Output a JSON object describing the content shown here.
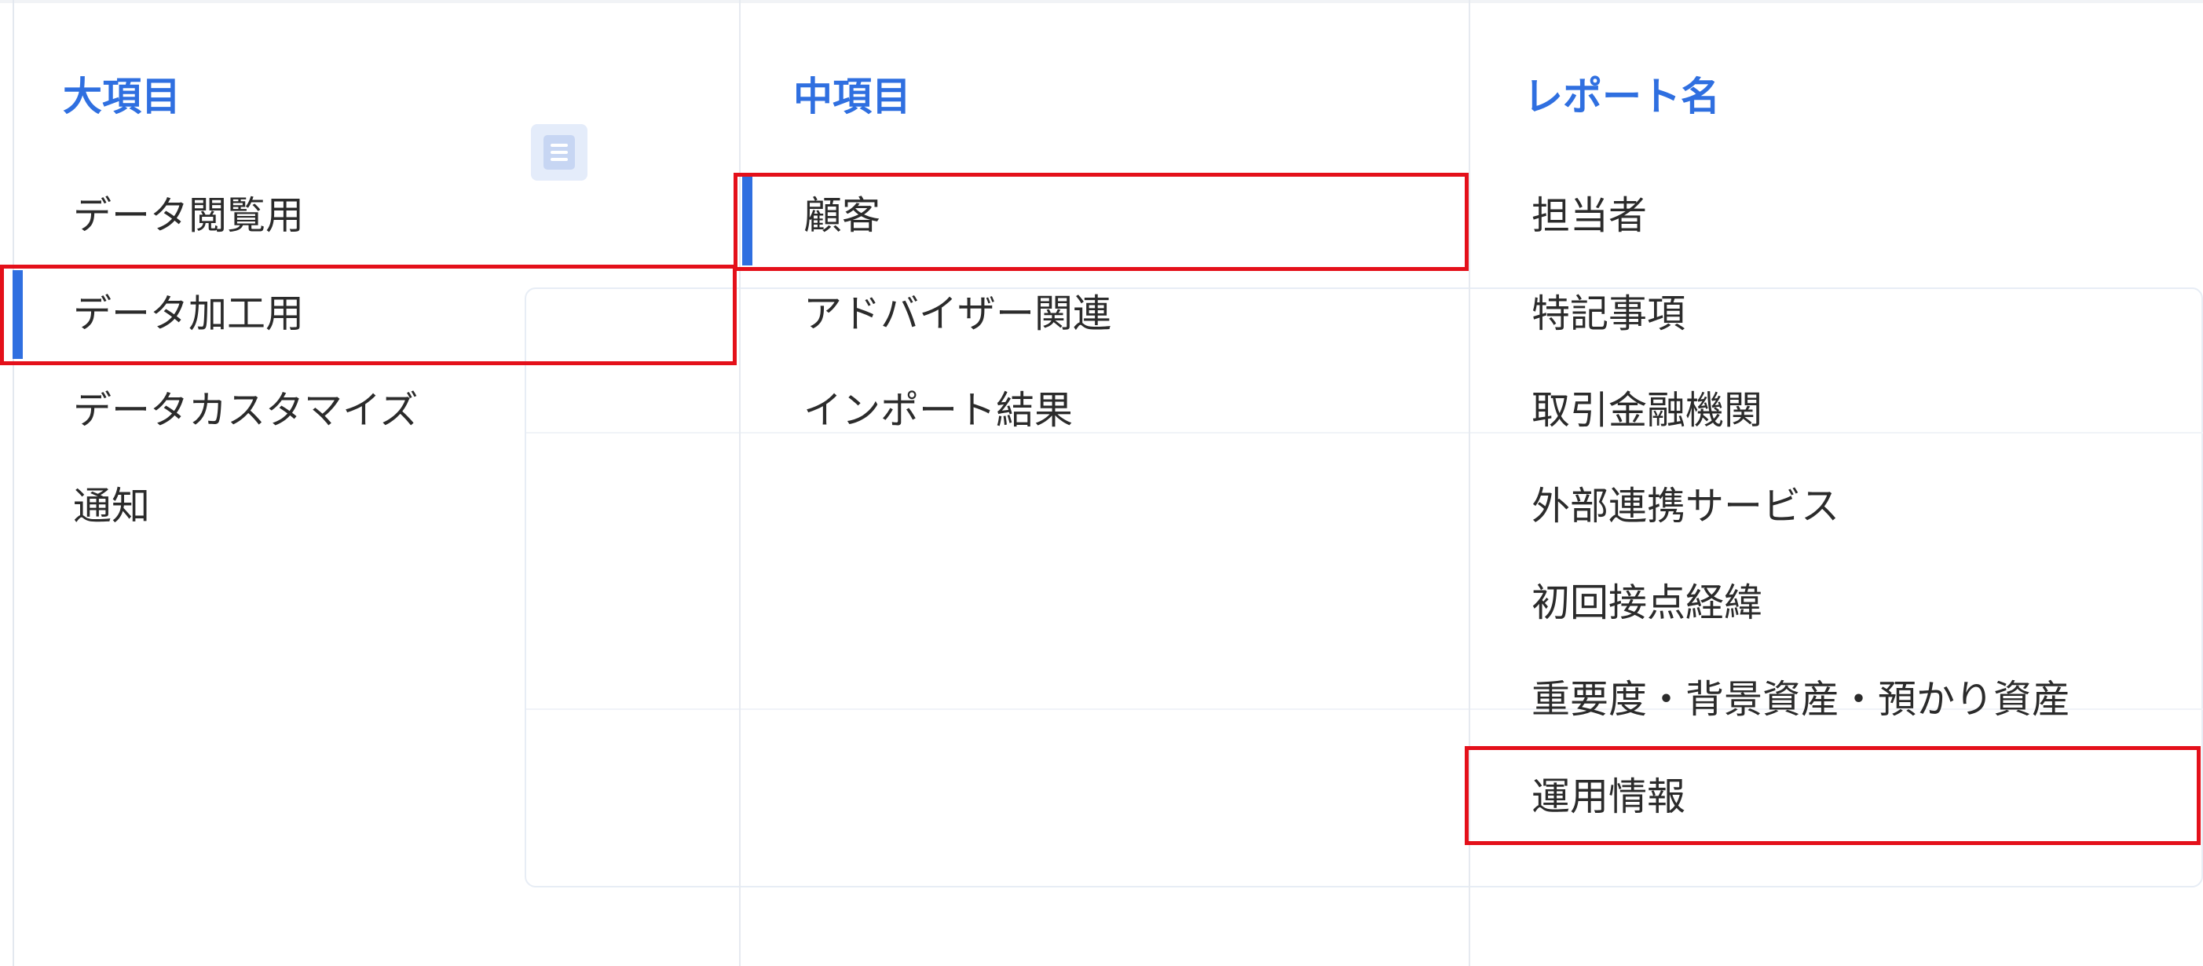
{
  "columns": {
    "major": {
      "header": "大項目",
      "items": [
        "データ閲覧用",
        "データ加工用",
        "データカスタマイズ",
        "通知"
      ],
      "selected_index": 1
    },
    "middle": {
      "header": "中項目",
      "items": [
        "顧客",
        "アドバイザー関連",
        "インポート結果"
      ],
      "selected_index": 0
    },
    "report": {
      "header": "レポート名",
      "items": [
        "担当者",
        "特記事項",
        "取引金融機関",
        "外部連携サービス",
        "初回接点経緯",
        "重要度・背景資産・預かり資産",
        "運用情報"
      ],
      "highlighted_index": 6
    }
  },
  "icons": {
    "document": "document-icon"
  },
  "colors": {
    "accent": "#2f6fe0",
    "highlight_border": "#e4101a",
    "text": "#2b2b2b"
  }
}
